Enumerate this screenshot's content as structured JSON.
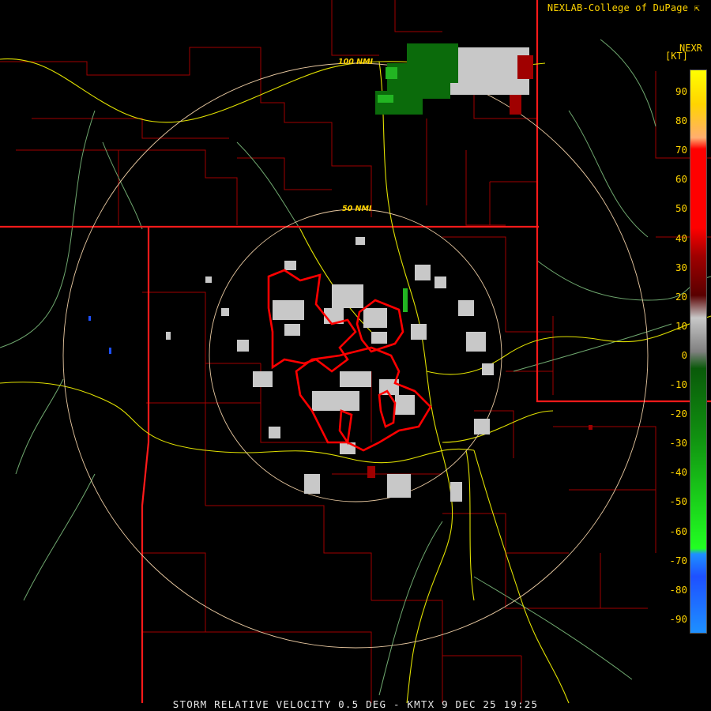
{
  "credit_text": "NEXLAB-College of DuPage",
  "credit_icon": "external-link-icon",
  "product_code": "NEXR",
  "units": "[KT]",
  "range_rings": [
    "100 NMI",
    "50 NMI"
  ],
  "footer": "STORM RELATIVE VELOCITY 0.5 DEG - KMTX 9 DEC 25 19:25",
  "legend": {
    "ticks": [
      "90",
      "80",
      "70",
      "60",
      "50",
      "40",
      "30",
      "20",
      "10",
      "0",
      "-10",
      "-20",
      "-30",
      "-40",
      "-50",
      "-60",
      "-70",
      "-80",
      "-90"
    ],
    "colors": {
      "outbound_high": "#ffff00",
      "outbound_mid": "#ff0000",
      "outbound_low": "#5a0000",
      "near_zero": "#c8c8c8",
      "inbound_low": "#0a5a0a",
      "inbound_high": "#22ff22",
      "inbound_extreme": "#1e90ff"
    }
  },
  "map_colors": {
    "state_borders": "#ff1a1a",
    "county_borders": "#b00000",
    "highways": "#e6e600",
    "rivers": "#7fbf7f",
    "range_rings": "#e8c8a0",
    "warning_polygons": "#ff0000"
  }
}
